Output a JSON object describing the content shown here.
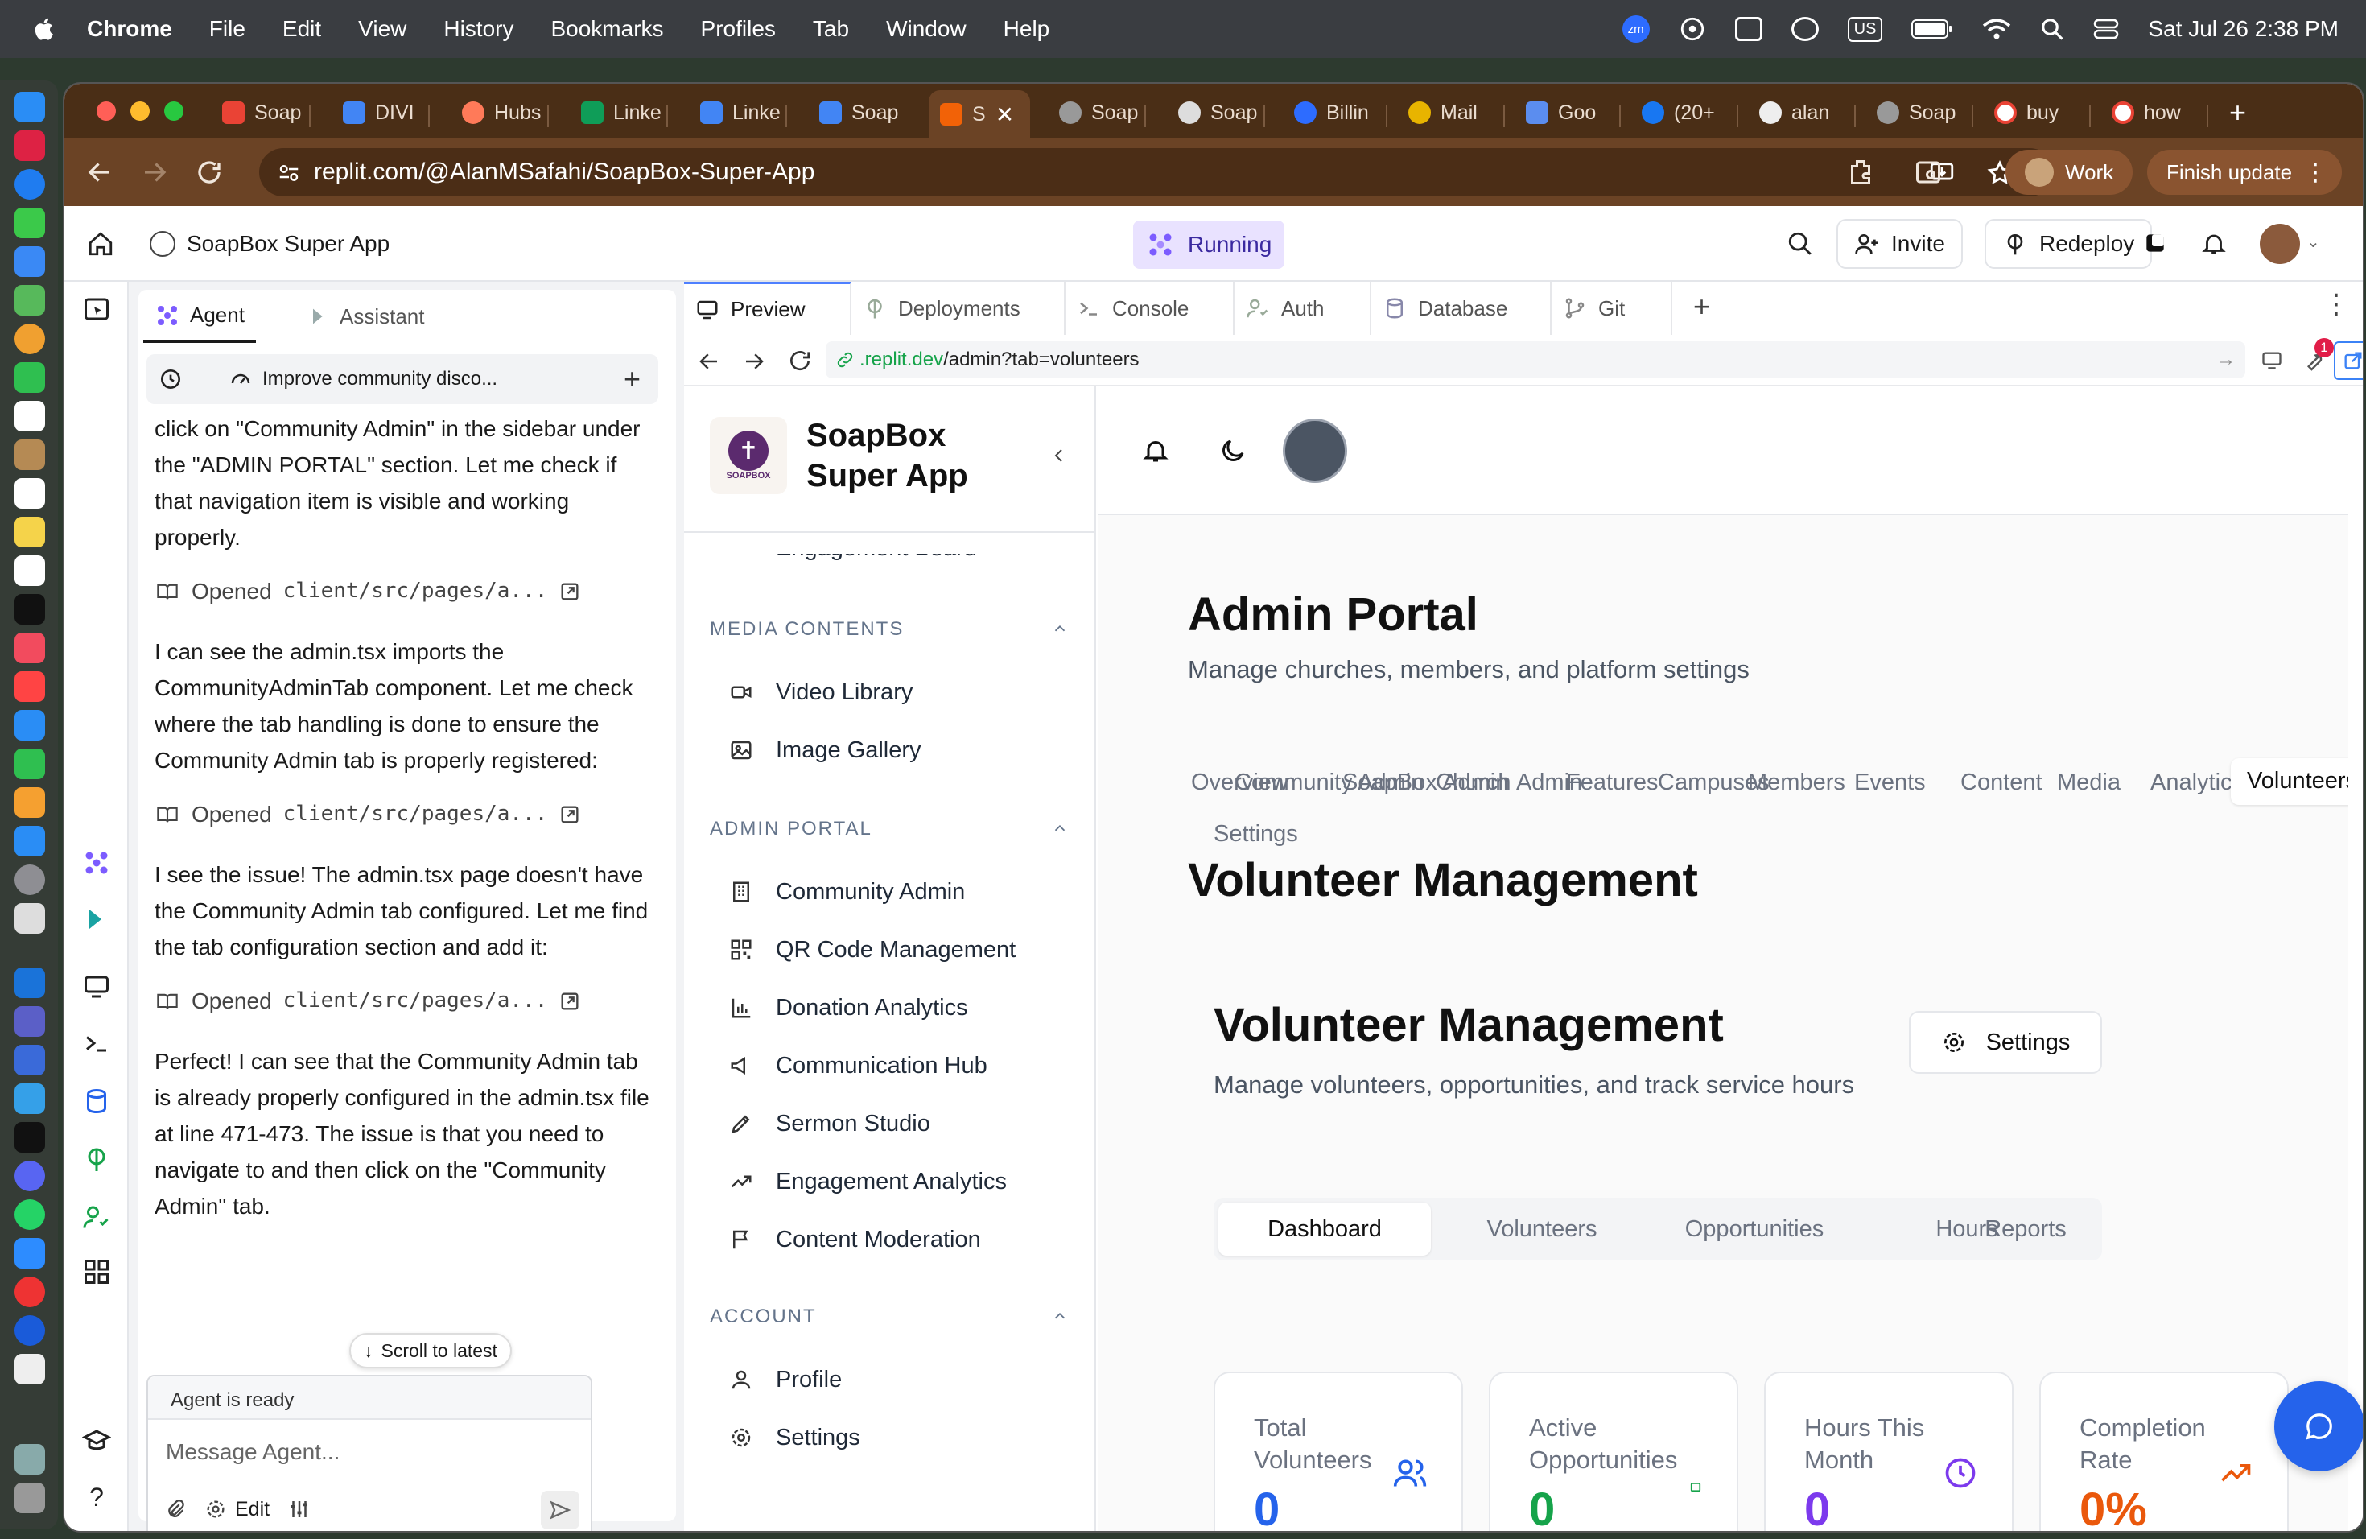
{
  "menubar": {
    "app": "Chrome",
    "items": [
      "File",
      "Edit",
      "View",
      "History",
      "Bookmarks",
      "Profiles",
      "Tab",
      "Window",
      "Help"
    ],
    "input_source": "US",
    "datetime": "Sat Jul 26  2:38 PM",
    "zoom_badge": "zm"
  },
  "browser": {
    "tabs": [
      {
        "label": "Soap",
        "icon": "gmail-icon"
      },
      {
        "label": "DIVI",
        "icon": "docs-icon"
      },
      {
        "label": "Hubs",
        "icon": "hubspot-icon"
      },
      {
        "label": "Linke",
        "icon": "sheets-icon"
      },
      {
        "label": "Linke",
        "icon": "docs-icon"
      },
      {
        "label": "Soap",
        "icon": "docs-icon"
      },
      {
        "label": "S",
        "icon": "replit-icon",
        "active": true
      },
      {
        "label": "Soap",
        "icon": "globe-icon"
      },
      {
        "label": "Soap",
        "icon": "openai-icon"
      },
      {
        "label": "Billin",
        "icon": "billing-icon"
      },
      {
        "label": "Mail",
        "icon": "mail-icon"
      },
      {
        "label": "Goo",
        "icon": "gemini-icon"
      },
      {
        "label": "(20+",
        "icon": "facebook-icon"
      },
      {
        "label": "alan",
        "icon": "github-icon"
      },
      {
        "label": "Soap",
        "icon": "globe-icon"
      },
      {
        "label": "buy",
        "icon": "google-icon"
      },
      {
        "label": "how",
        "icon": "google-icon"
      }
    ],
    "url": "replit.com/@AlanMSafahi/SoapBox-Super-App",
    "profile_label": "Work",
    "update_label": "Finish update"
  },
  "replit": {
    "project_name": "SoapBox Super App",
    "status": "Running",
    "invite_label": "Invite",
    "redeploy_label": "Redeploy",
    "agent_tabs": [
      "Agent",
      "Assistant"
    ],
    "agent_thread_title": "Improve community disco...",
    "messages": [
      {
        "type": "text",
        "text": "click on \"Community Admin\" in the sidebar under the \"ADMIN PORTAL\" section. Let me check if that navigation item is visible and working properly."
      },
      {
        "type": "opened",
        "label": "Opened",
        "path": "client/src/pages/a..."
      },
      {
        "type": "text",
        "text": "I can see the admin.tsx imports the CommunityAdminTab component. Let me check where the tab handling is done to ensure the Community Admin tab is properly registered:"
      },
      {
        "type": "opened",
        "label": "Opened",
        "path": "client/src/pages/a..."
      },
      {
        "type": "text",
        "text": "I see the issue! The admin.tsx page doesn't have the Community Admin tab configured. Let me find the tab configuration section and add it:"
      },
      {
        "type": "opened",
        "label": "Opened",
        "path": "client/src/pages/a..."
      },
      {
        "type": "text",
        "text": "Perfect! I can see that the Community Admin tab is already properly configured in the admin.tsx file at line 471-473. The issue is that you need to navigate to             and then click on the \"Community Admin\" tab."
      }
    ],
    "scroll_latest": "Scroll to latest",
    "agent_status": "Agent is ready",
    "message_placeholder": "Message Agent...",
    "edit_label": "Edit",
    "preview_tabs": [
      "Preview",
      "Deployments",
      "Console",
      "Auth",
      "Database",
      "Git"
    ],
    "preview_url_domain": ".replit.dev",
    "preview_url_path": "/admin?tab=volunteers",
    "notification_count": "1"
  },
  "site": {
    "brand_line1": "SoapBox",
    "brand_line2": "Super App",
    "logo_text": "SOAPBOX",
    "cut_item": "Engagement Board",
    "sections": [
      {
        "title": "MEDIA CONTENTS",
        "items": [
          {
            "label": "Video Library",
            "icon": "video-icon"
          },
          {
            "label": "Image Gallery",
            "icon": "image-icon"
          }
        ]
      },
      {
        "title": "ADMIN PORTAL",
        "items": [
          {
            "label": "Community Admin",
            "icon": "building-icon"
          },
          {
            "label": "QR Code Management",
            "icon": "qr-icon"
          },
          {
            "label": "Donation Analytics",
            "icon": "bar-chart-icon"
          },
          {
            "label": "Communication Hub",
            "icon": "megaphone-icon"
          },
          {
            "label": "Sermon Studio",
            "icon": "pen-tool-icon"
          },
          {
            "label": "Engagement Analytics",
            "icon": "trend-up-icon"
          },
          {
            "label": "Content Moderation",
            "icon": "flag-icon"
          }
        ]
      },
      {
        "title": "ACCOUNT",
        "items": [
          {
            "label": "Profile",
            "icon": "user-icon"
          },
          {
            "label": "Settings",
            "icon": "gear-icon"
          }
        ]
      }
    ],
    "page_title": "Admin Portal",
    "page_subtitle": "Manage churches, members, and platform settings",
    "admin_tabs": [
      "Overview",
      "Community Admin",
      "SoapBox Admin",
      "Church Admin",
      "Features",
      "Campuses",
      "Members",
      "Events",
      "Content",
      "Media",
      "Analytics",
      "Volunteers",
      "Settings"
    ],
    "active_admin_tab": "Volunteers",
    "section_title": "Volunteer Management",
    "vm_title": "Volunteer Management",
    "vm_subtitle": "Manage volunteers, opportunities, and track service hours",
    "vm_settings": "Settings",
    "vm_tabs": [
      "Dashboard",
      "Volunteers",
      "Opportunities",
      "Hours",
      "Reports"
    ],
    "stats": [
      {
        "label": "Total Volunteers",
        "value": "0",
        "color": "#2563eb",
        "icon": "users-icon"
      },
      {
        "label": "Active Opportunities",
        "value": "0",
        "color": "#16a34a",
        "icon": "calendar-icon"
      },
      {
        "label": "Hours This Month",
        "value": "0",
        "color": "#7c3aed",
        "icon": "clock-icon"
      },
      {
        "label": "Completion Rate",
        "value": "0%",
        "color": "#ea580c",
        "icon": "trend-up-icon"
      }
    ]
  }
}
